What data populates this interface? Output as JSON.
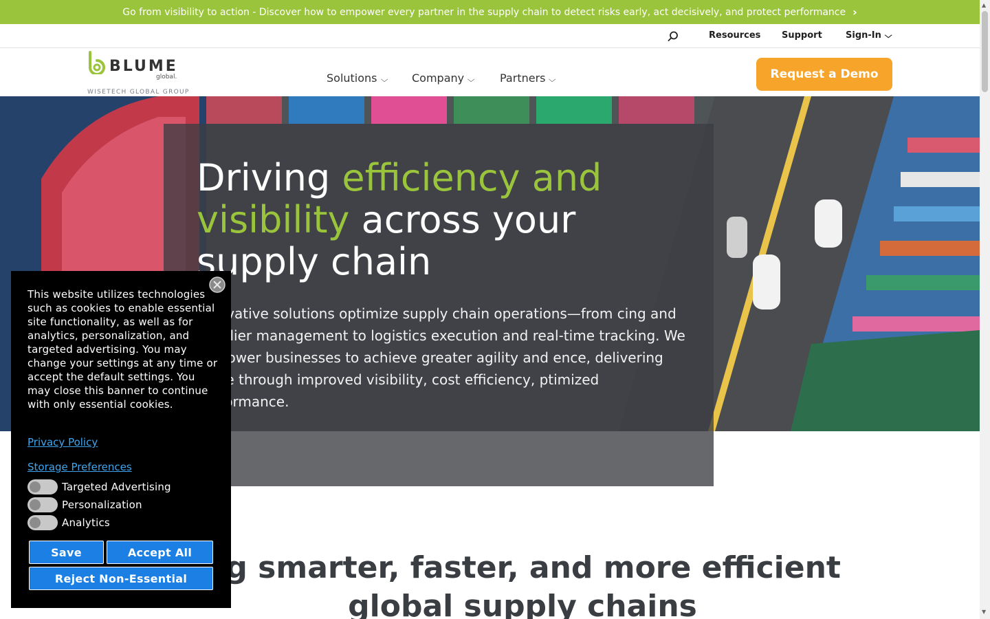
{
  "announcement": {
    "text": "Go from visibility to action - Discover how to empower every partner in the supply chain to detect risks early, act decisively, and protect performance",
    "icon": "chevron-right-icon",
    "bg_color": "#9ac43b"
  },
  "utility_nav": {
    "search_icon": "search-icon",
    "resources": "Resources",
    "support": "Support",
    "signin": "Sign-In"
  },
  "logo": {
    "brand": "BLUME",
    "sub": "global.",
    "group": "WISETECH GLOBAL GROUP"
  },
  "main_nav": {
    "solutions": "Solutions",
    "company": "Company",
    "partners": "Partners"
  },
  "cta": {
    "label": "Request a Demo",
    "color": "#f6a42a"
  },
  "hero": {
    "title_part1": "Driving ",
    "title_highlight1": "efficiency and",
    "title_highlight2": "visibility",
    "title_part2": " across your supply chain",
    "body": "innovative solutions optimize supply chain operations—from cing and supplier management to logistics execution and real-time tracking. We empower businesses to achieve greater agility and ence, delivering value through improved visibility, cost efficiency, ptimized performance.",
    "accent_color": "#9ac43b"
  },
  "section": {
    "heading": "ng smarter, faster, and more efficient global supply chains"
  },
  "cookie_banner": {
    "text": "This website utilizes technologies such as cookies to enable essential site functionality, as well as for analytics, personalization, and targeted advertising. You may change your settings at any time or accept the default settings. You may close this banner to continue with only essential cookies.",
    "privacy_link": "Privacy Policy",
    "storage_link": "Storage Preferences",
    "toggles": [
      {
        "label": "Targeted Advertising",
        "on": false
      },
      {
        "label": "Personalization",
        "on": false
      },
      {
        "label": "Analytics",
        "on": false
      }
    ],
    "save": "Save",
    "accept": "Accept All",
    "reject": "Reject Non-Essential",
    "button_color": "#1b7fe3"
  }
}
